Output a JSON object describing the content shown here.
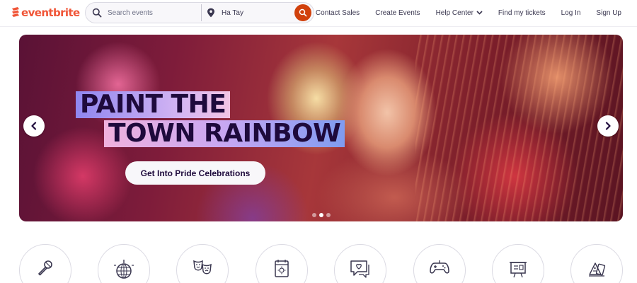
{
  "brand": {
    "name": "eventbrite",
    "color": "#f05537"
  },
  "search": {
    "placeholder": "Search events",
    "icon": "search-icon"
  },
  "location": {
    "value": "Ha Tay",
    "icon": "location-pin-icon"
  },
  "search_button": {
    "icon": "search-icon",
    "color": "#d1410c"
  },
  "nav": {
    "contact_sales": "Contact Sales",
    "create_events": "Create Events",
    "help_center": "Help Center",
    "find_tickets": "Find my tickets",
    "log_in": "Log In",
    "sign_up": "Sign Up"
  },
  "hero": {
    "headline_line1": "PAINT THE",
    "headline_line2": "TOWN RAINBOW",
    "cta": "Get Into Pride Celebrations",
    "carousel": {
      "slide_count": 3,
      "active_slide": 2
    }
  },
  "categories": [
    {
      "icon": "microphone-icon"
    },
    {
      "icon": "disco-ball-icon"
    },
    {
      "icon": "theater-masks-icon"
    },
    {
      "icon": "calendar-sun-icon"
    },
    {
      "icon": "chat-heart-icon"
    },
    {
      "icon": "gamepad-icon"
    },
    {
      "icon": "presentation-board-icon"
    },
    {
      "icon": "art-supplies-icon"
    }
  ]
}
